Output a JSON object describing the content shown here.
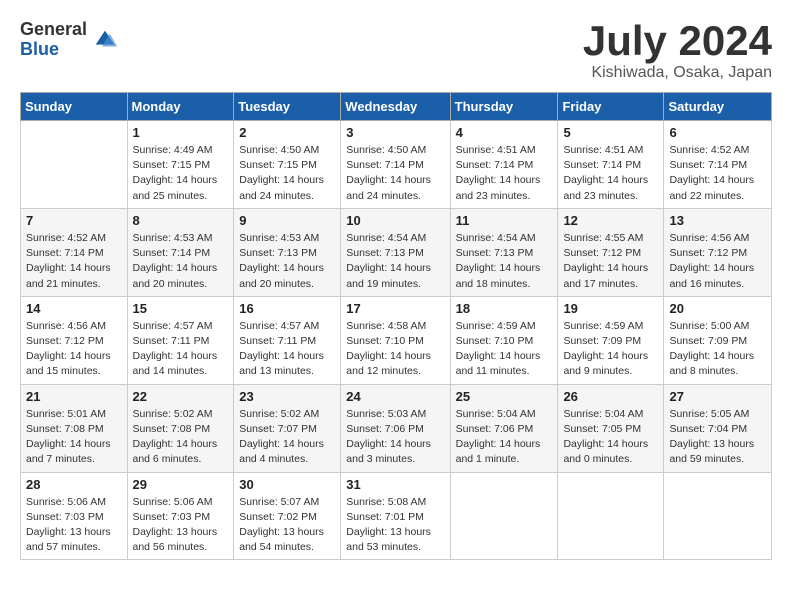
{
  "logo": {
    "general": "General",
    "blue": "Blue"
  },
  "title": "July 2024",
  "location": "Kishiwada, Osaka, Japan",
  "headers": [
    "Sunday",
    "Monday",
    "Tuesday",
    "Wednesday",
    "Thursday",
    "Friday",
    "Saturday"
  ],
  "weeks": [
    [
      {
        "day": "",
        "info": ""
      },
      {
        "day": "1",
        "info": "Sunrise: 4:49 AM\nSunset: 7:15 PM\nDaylight: 14 hours\nand 25 minutes."
      },
      {
        "day": "2",
        "info": "Sunrise: 4:50 AM\nSunset: 7:15 PM\nDaylight: 14 hours\nand 24 minutes."
      },
      {
        "day": "3",
        "info": "Sunrise: 4:50 AM\nSunset: 7:14 PM\nDaylight: 14 hours\nand 24 minutes."
      },
      {
        "day": "4",
        "info": "Sunrise: 4:51 AM\nSunset: 7:14 PM\nDaylight: 14 hours\nand 23 minutes."
      },
      {
        "day": "5",
        "info": "Sunrise: 4:51 AM\nSunset: 7:14 PM\nDaylight: 14 hours\nand 23 minutes."
      },
      {
        "day": "6",
        "info": "Sunrise: 4:52 AM\nSunset: 7:14 PM\nDaylight: 14 hours\nand 22 minutes."
      }
    ],
    [
      {
        "day": "7",
        "info": "Sunrise: 4:52 AM\nSunset: 7:14 PM\nDaylight: 14 hours\nand 21 minutes."
      },
      {
        "day": "8",
        "info": "Sunrise: 4:53 AM\nSunset: 7:14 PM\nDaylight: 14 hours\nand 20 minutes."
      },
      {
        "day": "9",
        "info": "Sunrise: 4:53 AM\nSunset: 7:13 PM\nDaylight: 14 hours\nand 20 minutes."
      },
      {
        "day": "10",
        "info": "Sunrise: 4:54 AM\nSunset: 7:13 PM\nDaylight: 14 hours\nand 19 minutes."
      },
      {
        "day": "11",
        "info": "Sunrise: 4:54 AM\nSunset: 7:13 PM\nDaylight: 14 hours\nand 18 minutes."
      },
      {
        "day": "12",
        "info": "Sunrise: 4:55 AM\nSunset: 7:12 PM\nDaylight: 14 hours\nand 17 minutes."
      },
      {
        "day": "13",
        "info": "Sunrise: 4:56 AM\nSunset: 7:12 PM\nDaylight: 14 hours\nand 16 minutes."
      }
    ],
    [
      {
        "day": "14",
        "info": "Sunrise: 4:56 AM\nSunset: 7:12 PM\nDaylight: 14 hours\nand 15 minutes."
      },
      {
        "day": "15",
        "info": "Sunrise: 4:57 AM\nSunset: 7:11 PM\nDaylight: 14 hours\nand 14 minutes."
      },
      {
        "day": "16",
        "info": "Sunrise: 4:57 AM\nSunset: 7:11 PM\nDaylight: 14 hours\nand 13 minutes."
      },
      {
        "day": "17",
        "info": "Sunrise: 4:58 AM\nSunset: 7:10 PM\nDaylight: 14 hours\nand 12 minutes."
      },
      {
        "day": "18",
        "info": "Sunrise: 4:59 AM\nSunset: 7:10 PM\nDaylight: 14 hours\nand 11 minutes."
      },
      {
        "day": "19",
        "info": "Sunrise: 4:59 AM\nSunset: 7:09 PM\nDaylight: 14 hours\nand 9 minutes."
      },
      {
        "day": "20",
        "info": "Sunrise: 5:00 AM\nSunset: 7:09 PM\nDaylight: 14 hours\nand 8 minutes."
      }
    ],
    [
      {
        "day": "21",
        "info": "Sunrise: 5:01 AM\nSunset: 7:08 PM\nDaylight: 14 hours\nand 7 minutes."
      },
      {
        "day": "22",
        "info": "Sunrise: 5:02 AM\nSunset: 7:08 PM\nDaylight: 14 hours\nand 6 minutes."
      },
      {
        "day": "23",
        "info": "Sunrise: 5:02 AM\nSunset: 7:07 PM\nDaylight: 14 hours\nand 4 minutes."
      },
      {
        "day": "24",
        "info": "Sunrise: 5:03 AM\nSunset: 7:06 PM\nDaylight: 14 hours\nand 3 minutes."
      },
      {
        "day": "25",
        "info": "Sunrise: 5:04 AM\nSunset: 7:06 PM\nDaylight: 14 hours\nand 1 minute."
      },
      {
        "day": "26",
        "info": "Sunrise: 5:04 AM\nSunset: 7:05 PM\nDaylight: 14 hours\nand 0 minutes."
      },
      {
        "day": "27",
        "info": "Sunrise: 5:05 AM\nSunset: 7:04 PM\nDaylight: 13 hours\nand 59 minutes."
      }
    ],
    [
      {
        "day": "28",
        "info": "Sunrise: 5:06 AM\nSunset: 7:03 PM\nDaylight: 13 hours\nand 57 minutes."
      },
      {
        "day": "29",
        "info": "Sunrise: 5:06 AM\nSunset: 7:03 PM\nDaylight: 13 hours\nand 56 minutes."
      },
      {
        "day": "30",
        "info": "Sunrise: 5:07 AM\nSunset: 7:02 PM\nDaylight: 13 hours\nand 54 minutes."
      },
      {
        "day": "31",
        "info": "Sunrise: 5:08 AM\nSunset: 7:01 PM\nDaylight: 13 hours\nand 53 minutes."
      },
      {
        "day": "",
        "info": ""
      },
      {
        "day": "",
        "info": ""
      },
      {
        "day": "",
        "info": ""
      }
    ]
  ]
}
